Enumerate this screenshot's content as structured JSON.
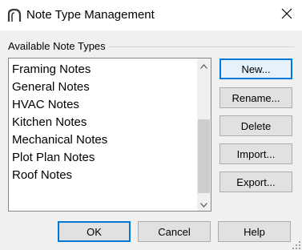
{
  "window": {
    "title": "Note Type Management",
    "close_icon": "close-icon",
    "app_icon": "arch-icon"
  },
  "group": {
    "label": "Available Note Types"
  },
  "list": {
    "items": [
      "Framing Notes",
      "General Notes",
      "HVAC Notes",
      "Kitchen Notes",
      "Mechanical Notes",
      "Plot Plan Notes",
      "Roof Notes"
    ]
  },
  "buttons": {
    "new": "New...",
    "rename": "Rename...",
    "delete": "Delete",
    "import": "Import...",
    "export": "Export...",
    "ok": "OK",
    "cancel": "Cancel",
    "help": "Help"
  },
  "colors": {
    "accent": "#0078d7",
    "background": "#f0f0f0"
  }
}
